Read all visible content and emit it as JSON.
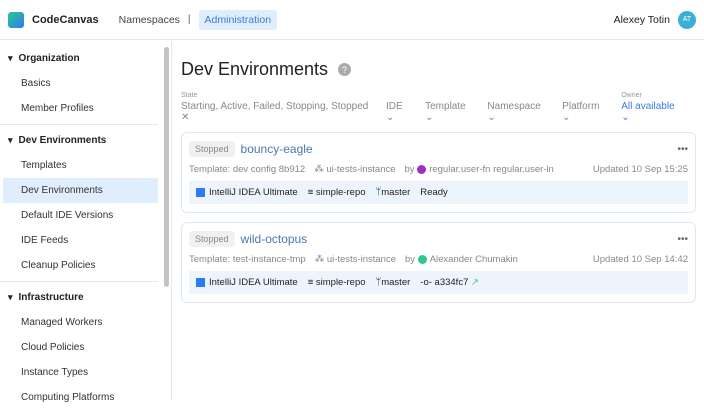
{
  "header": {
    "brand": "CodeCanvas",
    "nav": [
      "Namespaces",
      "Administration"
    ],
    "separator": "|",
    "user": "Alexey Totin",
    "user_initials": "AT"
  },
  "sidebar": {
    "sections": [
      {
        "label": "Organization",
        "items": [
          "Basics",
          "Member Profiles"
        ]
      },
      {
        "label": "Dev Environments",
        "items": [
          "Templates",
          "Dev Environments",
          "Default IDE Versions",
          "IDE Feeds",
          "Cleanup Policies"
        ]
      },
      {
        "label": "Infrastructure",
        "items": [
          "Managed Workers",
          "Cloud Policies",
          "Instance Types",
          "Computing Platforms"
        ]
      }
    ],
    "active": "Dev Environments"
  },
  "main": {
    "title": "Dev Environments",
    "help": "?",
    "filters": {
      "state_label": "State",
      "state_value": "Starting, Active, Failed, Stopping, Stopped",
      "clear": "✕",
      "ide": "IDE",
      "template": "Template",
      "namespace": "Namespace",
      "platform": "Platform",
      "owner_label": "Owner",
      "owner_value": "All available"
    },
    "cards": [
      {
        "status": "Stopped",
        "name": "bouncy-eagle",
        "template": "Template: dev config 8b912",
        "instance": "ui-tests-instance",
        "by": "by",
        "user": "regular.user-fn regular.user-ln",
        "avatar_color": "#9b30c8",
        "updated": "Updated 10 Sep 15:25",
        "ide": "IntelliJ IDEA Ultimate",
        "repo": "simple-repo",
        "branch": "master",
        "extra": "Ready"
      },
      {
        "status": "Stopped",
        "name": "wild-octopus",
        "template": "Template: test-instance-tmp",
        "instance": "ui-tests-instance",
        "by": "by",
        "user": "Alexander Chumakin",
        "avatar_color": "#2ec98a",
        "updated": "Updated 10 Sep 14:42",
        "ide": "IntelliJ IDEA Ultimate",
        "repo": "simple-repo",
        "branch": "master",
        "extra": "a334fc7"
      }
    ]
  }
}
